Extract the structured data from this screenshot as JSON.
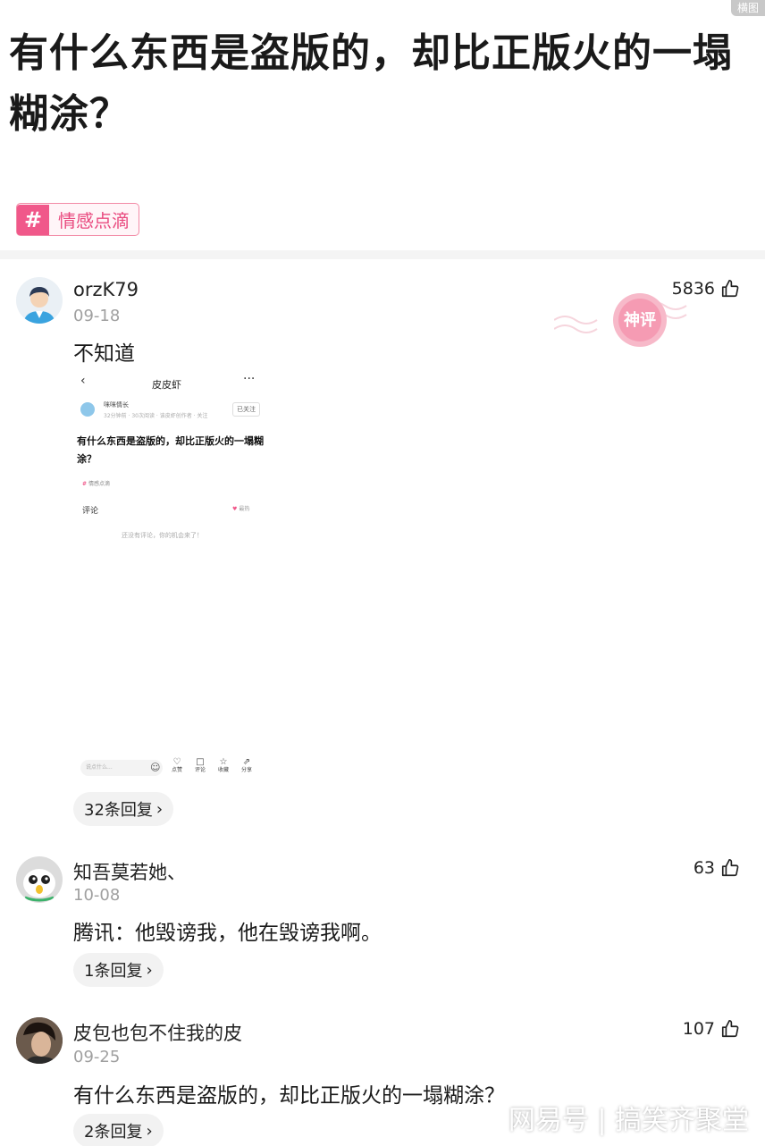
{
  "corner_badge": "横图",
  "post": {
    "title": "有什么东西是盗版的，却比正版火的一塌糊涂？",
    "topic_tag": "情感点滴"
  },
  "stamp_text": "神评",
  "comments": [
    {
      "username": "orzK79",
      "date": "09-18",
      "text": "不知道",
      "likes": "5836",
      "replies": "32条回复"
    },
    {
      "username": "知吾莫若她、",
      "date": "10-08",
      "text": "腾讯：他毁谤我，他在毁谤我啊。",
      "likes": "63",
      "replies": "1条回复"
    },
    {
      "username": "皮包也包不住我的皮",
      "date": "09-25",
      "text": "有什么东西是盗版的，却比正版火的一塌糊涂？",
      "likes": "107",
      "replies": "2条回复"
    }
  ],
  "embedded_screenshot": {
    "nav_title": "皮皮虾",
    "author_name": "咪咪情长",
    "author_meta": "32分钟前 · 30次阅读 · 该皮虾创作者 · 关注",
    "follow_label": "已关注",
    "title": "有什么东西是盗版的，却比正版火的一塌糊涂？",
    "tag": "情感点滴",
    "comment_label": "评论",
    "hot_label": "最热",
    "empty_hint": "还没有评论，你的机会来了！",
    "input_placeholder": "说点什么...",
    "actions": [
      "点赞",
      "评论",
      "收藏",
      "分享"
    ]
  },
  "watermark": "网易号 | 搞笑齐聚堂"
}
